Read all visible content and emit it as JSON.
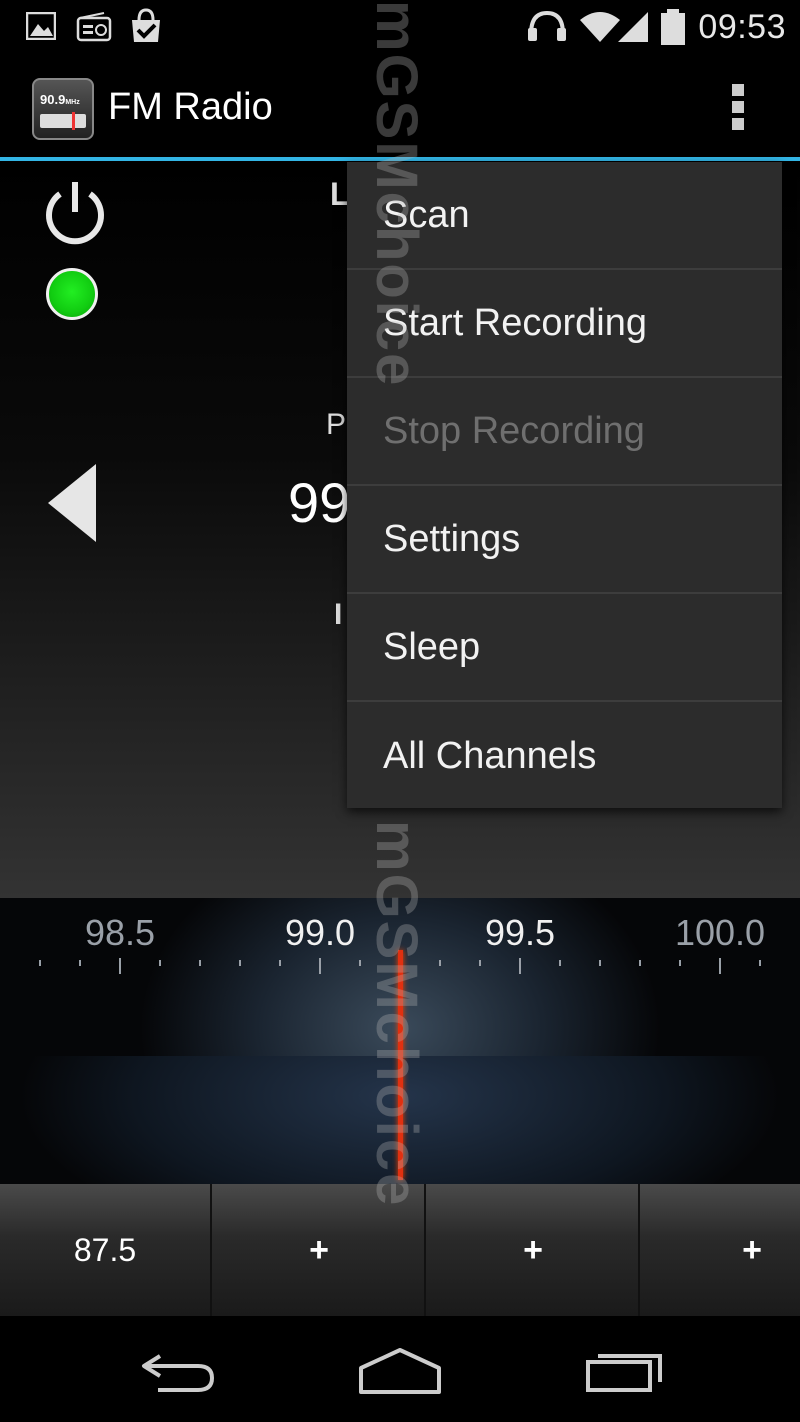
{
  "status_bar": {
    "time": "09:53",
    "left_icons": [
      "gallery-icon",
      "radio-icon",
      "shopping-bag-icon"
    ],
    "right_icons": [
      "headphones-icon",
      "wifi-icon",
      "signal-icon",
      "battery-icon"
    ]
  },
  "action_bar": {
    "app_icon_text": "90.9",
    "app_icon_unit": "MHz",
    "title": "FM Radio",
    "overflow_icon": "overflow-menu-icon",
    "accent_color": "#33b5e5"
  },
  "player": {
    "power_icon": "power-icon",
    "status_color": "#11cc11",
    "prev_icon": "prev-station-icon",
    "partial_texts": {
      "l": "L",
      "p": "P",
      "frequency": "99",
      "i": "I"
    }
  },
  "tuner": {
    "ticks": [
      "98.5",
      "99.0",
      "99.5",
      "100.0"
    ],
    "active_ticks": [
      "99.0",
      "99.5"
    ],
    "needle_color": "#e03010"
  },
  "presets": [
    {
      "label": "87.5"
    },
    {
      "label": "+"
    },
    {
      "label": "+"
    },
    {
      "label": "+"
    }
  ],
  "menu": {
    "items": [
      {
        "label": "Scan",
        "enabled": true
      },
      {
        "label": "Start Recording",
        "enabled": true
      },
      {
        "label": "Stop Recording",
        "enabled": false
      },
      {
        "label": "Settings",
        "enabled": true
      },
      {
        "label": "Sleep",
        "enabled": true
      },
      {
        "label": "All Channels",
        "enabled": true
      }
    ]
  },
  "nav_bar": {
    "icons": [
      "back-icon",
      "home-icon",
      "recent-apps-icon"
    ]
  },
  "watermark": "mGSMchoice"
}
